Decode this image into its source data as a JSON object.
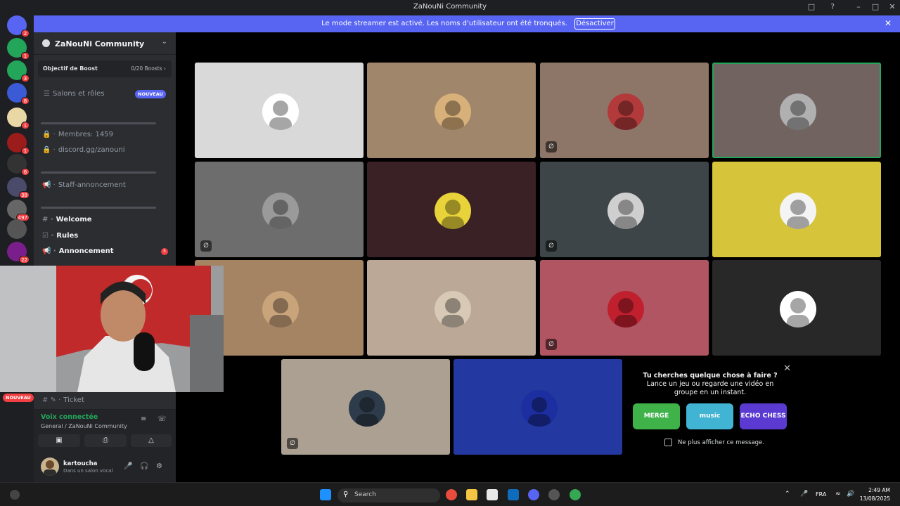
{
  "window": {
    "title": "ZaNouNi Community",
    "controls": [
      "–",
      "□",
      "✕"
    ]
  },
  "banner": {
    "message": "Le mode streamer est activé. Les noms d'utilisateur ont été tronqués.",
    "button": "Désactiver"
  },
  "rail": {
    "badges": [
      "2",
      "1",
      "3",
      "8",
      "1",
      "1",
      "6",
      "38",
      "497",
      "1",
      "22"
    ]
  },
  "sidebar": {
    "server_name": "ZaNouNi Community",
    "boost": {
      "label": "Objectif de Boost",
      "count": "0/20 Boosts ›"
    },
    "roles_item": "Salons et rôles",
    "roles_badge": "NOUVEAU",
    "members": "Membres: 1459",
    "invite": "discord.gg/zanouni",
    "staff": "Staff-annoncement",
    "welcome": "Welcome",
    "rules": "Rules",
    "annonce": "Annoncement",
    "annonce_badge": "5",
    "ticket": "Ticket",
    "cam_badge": "NOUVEAU"
  },
  "voice": {
    "status": "Voix connectée",
    "location": "General / ZaNouNi Community"
  },
  "user": {
    "name": "kartoucha",
    "status": "Dans un salon vocal"
  },
  "activity": {
    "line1": "Tu cherches quelque chose à faire ?",
    "line2": "Lance un jeu ou regarde une vidéo en groupe en un instant.",
    "cards": [
      "MERGE",
      "music",
      "ECHO CHESS"
    ],
    "checkbox_label": "Ne plus afficher ce message."
  },
  "tiles": {
    "colors": [
      "#d9d9d9",
      "#a0866b",
      "#8d7668",
      "#706360",
      "#6d6d6d",
      "#3a2125",
      "#3d4548",
      "#d6c43b",
      "#a58463",
      "#bba897",
      "#b05561",
      "#282828",
      "#aba092",
      "#2338a0"
    ],
    "muted_icon": "mic-off-icon",
    "speaking_tile": 4
  },
  "taskbar": {
    "search": "Search",
    "lang": "FRA",
    "time": "2:49 AM",
    "date": "13/08/2025"
  }
}
